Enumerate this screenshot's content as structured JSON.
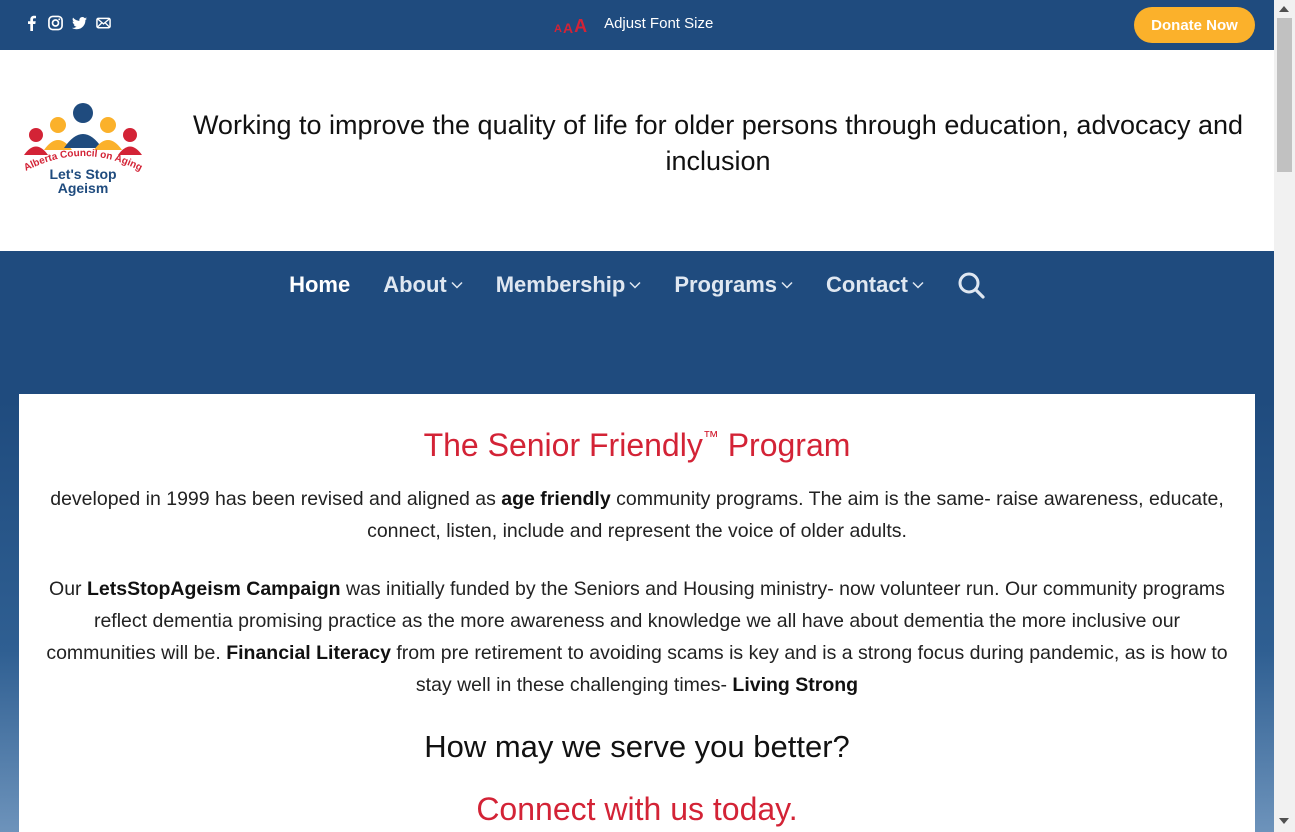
{
  "topbar": {
    "social_icons": [
      "facebook-icon",
      "instagram-icon",
      "twitter-icon",
      "email-icon"
    ],
    "font_size_letters": [
      "A",
      "A",
      "A"
    ],
    "font_size_label": "Adjust Font Size",
    "donate_label": "Donate Now"
  },
  "header": {
    "logo_text_arc": "Alberta Council on Aging",
    "logo_text_line1": "Let's Stop",
    "logo_text_line2": "Ageism",
    "tagline": "Working to improve the quality of life for older persons through education, advocacy and inclusion"
  },
  "nav": {
    "items": [
      {
        "label": "Home",
        "dropdown": false
      },
      {
        "label": "About",
        "dropdown": true
      },
      {
        "label": "Membership",
        "dropdown": true
      },
      {
        "label": "Programs",
        "dropdown": true
      },
      {
        "label": "Contact",
        "dropdown": true
      }
    ],
    "search_icon": "search-icon"
  },
  "content": {
    "title": "The Senior Friendly",
    "title_tm": "™",
    "title_suffix": " Program",
    "p1": {
      "a": "developed in 1999 has been revised and aligned as ",
      "b": "age friendly",
      "c": " community programs. The aim is the same- raise awareness, educate, connect, listen, include and represent the voice of older adults."
    },
    "p2": {
      "a": "Our ",
      "b": "LetsStopAgeism Campaign",
      "c": " was initially funded by the Seniors and Housing ministry- now volunteer run. Our community programs reflect dementia promising practice as the more awareness and knowledge we all have about dementia the more inclusive our communities will be. ",
      "d": "Financial Literacy",
      "e": " from pre retirement to avoiding scams is key and is a strong focus during pandemic, as is how to stay well in these challenging times- ",
      "f": "Living Strong"
    },
    "question": "How may we serve you better?",
    "cta": "Connect with us today."
  },
  "colors": {
    "brand_blue": "#1f4b7e",
    "accent_red": "#d32336",
    "donate_orange": "#fbb12b"
  }
}
